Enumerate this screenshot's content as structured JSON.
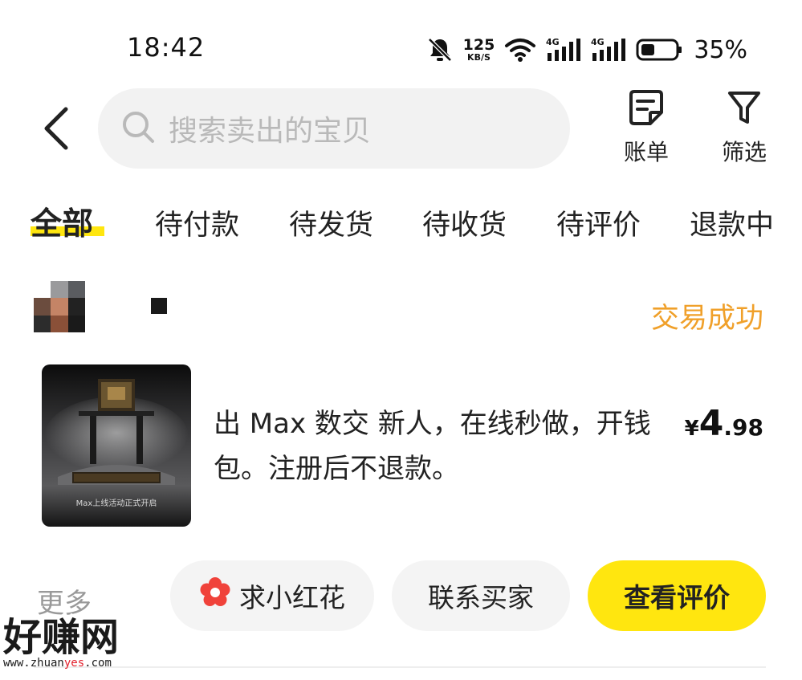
{
  "status_bar": {
    "time": "18:42",
    "net_speed_value": "125",
    "net_speed_unit": "KB/S",
    "signal_labels": [
      "4G",
      "4G"
    ],
    "battery_percent": "35%",
    "icons": [
      "mute-bell-icon",
      "wifi-icon",
      "signal-4g-icon",
      "signal-4g-icon",
      "battery-icon"
    ]
  },
  "header": {
    "search_placeholder": "搜索卖出的宝贝",
    "actions": [
      {
        "label": "账单",
        "icon": "bill-icon"
      },
      {
        "label": "筛选",
        "icon": "filter-icon"
      }
    ]
  },
  "tabs": [
    {
      "label": "全部",
      "active": true
    },
    {
      "label": "待付款",
      "active": false
    },
    {
      "label": "待发货",
      "active": false
    },
    {
      "label": "待收货",
      "active": false
    },
    {
      "label": "待评价",
      "active": false
    },
    {
      "label": "退款中",
      "active": false
    }
  ],
  "order": {
    "status": "交易成功",
    "product_title": "出 Max 数交 新人，在线秒做，开钱包。注册后不退款。",
    "product_thumb_caption": "Max上线活动正式开启",
    "price": {
      "symbol": "¥",
      "integer": "4",
      "decimal": ".98"
    },
    "more_label": "更多",
    "buttons": {
      "flower": "求小红花",
      "contact": "联系买家",
      "review": "查看评价"
    }
  },
  "watermark": {
    "brand": "好赚网",
    "url_prefix": "www.zhuan",
    "url_highlight": "yes",
    "url_suffix": ".com"
  },
  "colors": {
    "accent_yellow": "#ffe60f",
    "status_orange": "#f0a02a",
    "watermark_red": "#e3202c"
  }
}
